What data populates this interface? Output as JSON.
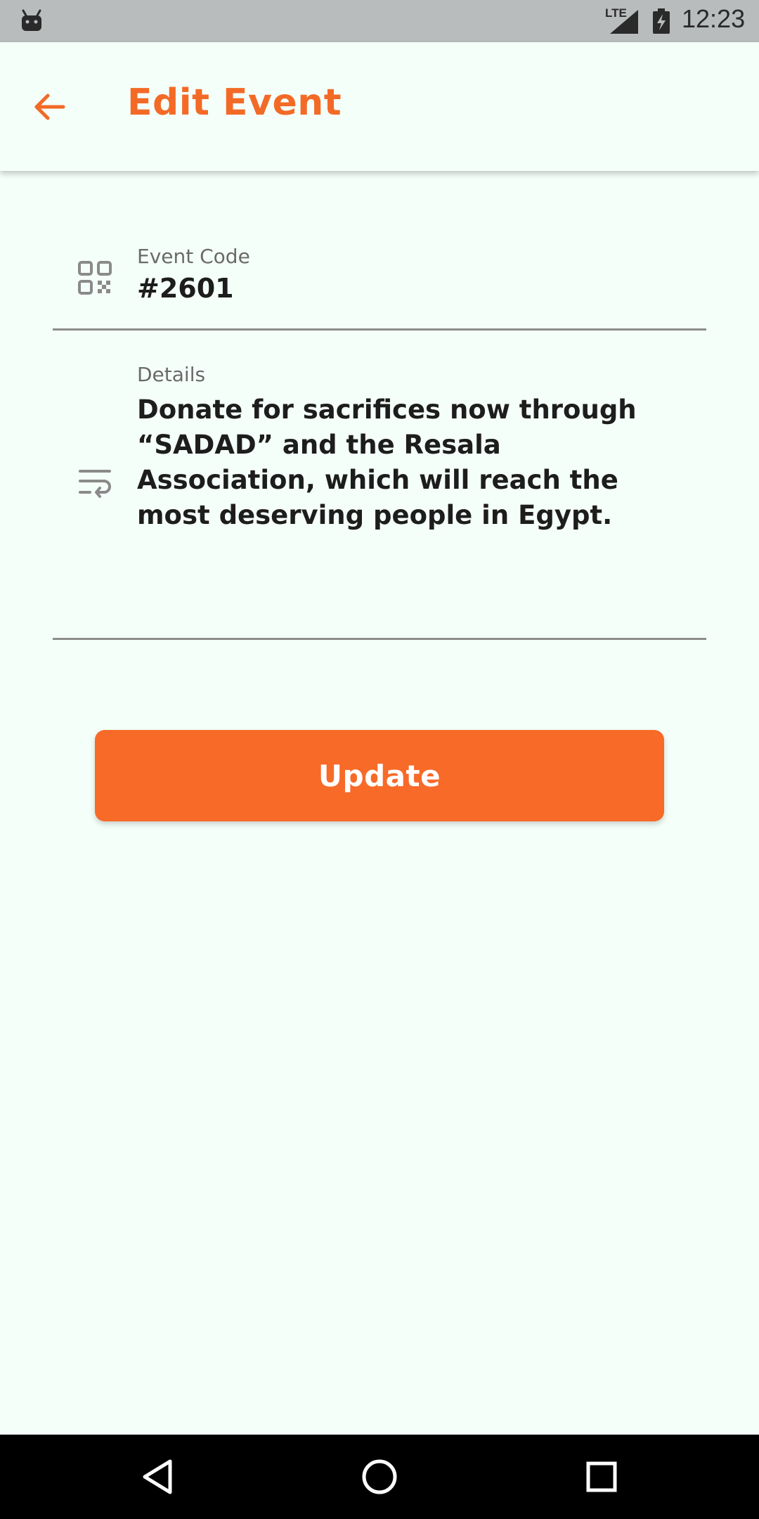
{
  "status_bar": {
    "network_label": "LTE",
    "time": "12:23"
  },
  "app_bar": {
    "title": "Edit Event",
    "back_icon": "arrow-left-icon"
  },
  "form": {
    "event_code": {
      "label": "Event Code",
      "value": "#2601",
      "icon": "qr-code-icon"
    },
    "details": {
      "label": "Details",
      "value": "Donate for sacrifices now through “SADAD” and the Resala Association, which will reach the most deserving people in Egypt.",
      "icon": "text-wrap-icon"
    }
  },
  "actions": {
    "update_label": "Update"
  },
  "nav_bar": {
    "back": "back-triangle-icon",
    "home": "home-circle-icon",
    "recents": "recents-square-icon"
  },
  "colors": {
    "accent": "#f36a27",
    "button": "#f76a28",
    "background": "#f5fff9",
    "status_bar": "#b9bcbc",
    "nav_bar": "#000000"
  }
}
